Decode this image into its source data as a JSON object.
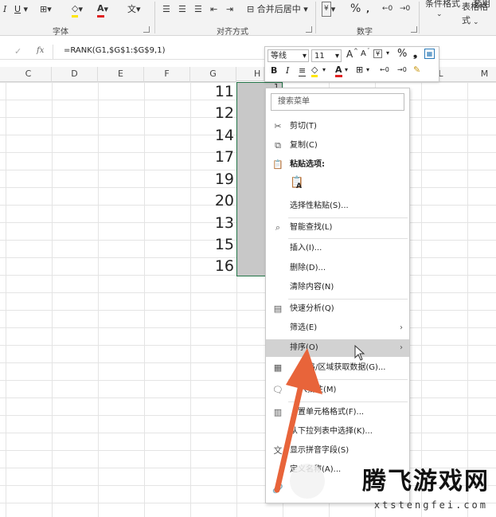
{
  "ribbon": {
    "font_group": "字体",
    "align_group": "对齐方式",
    "number_group": "数字",
    "merge_center": "合并后居中",
    "cond_format": "条件格式",
    "table_format_1": "套用",
    "table_format_2": "表格格式",
    "percent": "%"
  },
  "formula": {
    "fx": "fx",
    "content": "=RANK(G1,$G$1:$G$9,1)"
  },
  "columns": [
    "C",
    "D",
    "E",
    "F",
    "G",
    "H",
    "L",
    "M"
  ],
  "g_values": [
    "11",
    "12",
    "14",
    "17",
    "19",
    "20",
    "13",
    "15",
    "16"
  ],
  "h1_value": "1",
  "mini_toolbar": {
    "font": "等线",
    "size": "11",
    "grow": "A",
    "shrink": "A",
    "percent": "%",
    "bold": "B",
    "italic": "I"
  },
  "context_menu": {
    "search_placeholder": "搜索菜单",
    "items": {
      "cut": "剪切(T)",
      "copy": "复制(C)",
      "paste_options": "粘贴选项:",
      "paste_special": "选择性粘贴(S)...",
      "smart_lookup": "智能查找(L)",
      "insert": "插入(I)...",
      "delete": "删除(D)...",
      "clear": "清除内容(N)",
      "quick_analysis": "快速分析(Q)",
      "filter": "筛选(E)",
      "sort": "排序(O)",
      "from_table": "格/区域获取数据(G)...",
      "comment": "入批注(M)",
      "format_cells": "置单元格格式(F)...",
      "pick_list": "从下拉列表中选择(K)...",
      "phonetic": "显示拼音字段(S)",
      "define_name": "定义名称(A)..."
    }
  },
  "watermark": {
    "title": "腾飞游戏网",
    "url": "xtstengfei.com"
  },
  "colors": {
    "accent_arrow": "#e8643a",
    "selection_border": "#217346"
  }
}
